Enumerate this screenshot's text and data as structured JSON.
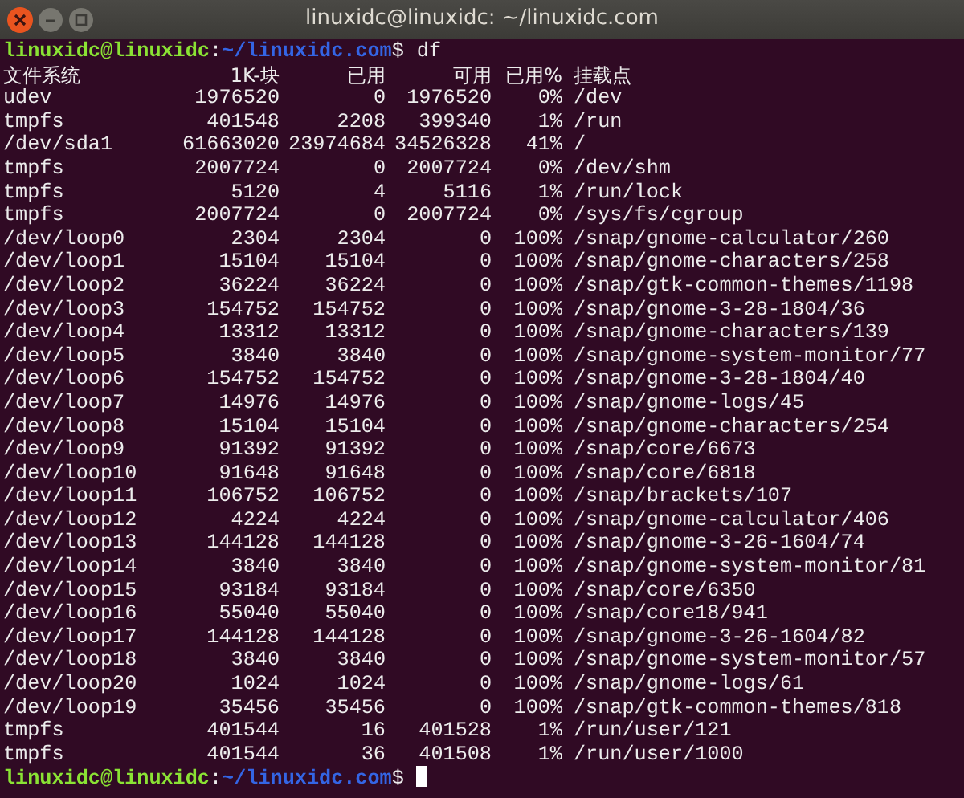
{
  "window": {
    "title": "linuxidc@linuxidc: ~/linuxidc.com"
  },
  "prompt": {
    "user_host": "linuxidc@linuxidc",
    "separator": ":",
    "path": "~/linuxidc.com",
    "symbol": "$",
    "command": "df"
  },
  "table": {
    "columns": [
      "文件系统",
      "1K-块",
      "已用",
      "可用",
      "已用%",
      "挂载点"
    ],
    "rows": [
      [
        "udev",
        "1976520",
        "0",
        "1976520",
        "0%",
        "/dev"
      ],
      [
        "tmpfs",
        "401548",
        "2208",
        "399340",
        "1%",
        "/run"
      ],
      [
        "/dev/sda1",
        "61663020",
        "23974684",
        "34526328",
        "41%",
        "/"
      ],
      [
        "tmpfs",
        "2007724",
        "0",
        "2007724",
        "0%",
        "/dev/shm"
      ],
      [
        "tmpfs",
        "5120",
        "4",
        "5116",
        "1%",
        "/run/lock"
      ],
      [
        "tmpfs",
        "2007724",
        "0",
        "2007724",
        "0%",
        "/sys/fs/cgroup"
      ],
      [
        "/dev/loop0",
        "2304",
        "2304",
        "0",
        "100%",
        "/snap/gnome-calculator/260"
      ],
      [
        "/dev/loop1",
        "15104",
        "15104",
        "0",
        "100%",
        "/snap/gnome-characters/258"
      ],
      [
        "/dev/loop2",
        "36224",
        "36224",
        "0",
        "100%",
        "/snap/gtk-common-themes/1198"
      ],
      [
        "/dev/loop3",
        "154752",
        "154752",
        "0",
        "100%",
        "/snap/gnome-3-28-1804/36"
      ],
      [
        "/dev/loop4",
        "13312",
        "13312",
        "0",
        "100%",
        "/snap/gnome-characters/139"
      ],
      [
        "/dev/loop5",
        "3840",
        "3840",
        "0",
        "100%",
        "/snap/gnome-system-monitor/77"
      ],
      [
        "/dev/loop6",
        "154752",
        "154752",
        "0",
        "100%",
        "/snap/gnome-3-28-1804/40"
      ],
      [
        "/dev/loop7",
        "14976",
        "14976",
        "0",
        "100%",
        "/snap/gnome-logs/45"
      ],
      [
        "/dev/loop8",
        "15104",
        "15104",
        "0",
        "100%",
        "/snap/gnome-characters/254"
      ],
      [
        "/dev/loop9",
        "91392",
        "91392",
        "0",
        "100%",
        "/snap/core/6673"
      ],
      [
        "/dev/loop10",
        "91648",
        "91648",
        "0",
        "100%",
        "/snap/core/6818"
      ],
      [
        "/dev/loop11",
        "106752",
        "106752",
        "0",
        "100%",
        "/snap/brackets/107"
      ],
      [
        "/dev/loop12",
        "4224",
        "4224",
        "0",
        "100%",
        "/snap/gnome-calculator/406"
      ],
      [
        "/dev/loop13",
        "144128",
        "144128",
        "0",
        "100%",
        "/snap/gnome-3-26-1604/74"
      ],
      [
        "/dev/loop14",
        "3840",
        "3840",
        "0",
        "100%",
        "/snap/gnome-system-monitor/81"
      ],
      [
        "/dev/loop15",
        "93184",
        "93184",
        "0",
        "100%",
        "/snap/core/6350"
      ],
      [
        "/dev/loop16",
        "55040",
        "55040",
        "0",
        "100%",
        "/snap/core18/941"
      ],
      [
        "/dev/loop17",
        "144128",
        "144128",
        "0",
        "100%",
        "/snap/gnome-3-26-1604/82"
      ],
      [
        "/dev/loop18",
        "3840",
        "3840",
        "0",
        "100%",
        "/snap/gnome-system-monitor/57"
      ],
      [
        "/dev/loop20",
        "1024",
        "1024",
        "0",
        "100%",
        "/snap/gnome-logs/61"
      ],
      [
        "/dev/loop19",
        "35456",
        "35456",
        "0",
        "100%",
        "/snap/gtk-common-themes/818"
      ],
      [
        "tmpfs",
        "401544",
        "16",
        "401528",
        "1%",
        "/run/user/121"
      ],
      [
        "tmpfs",
        "401544",
        "36",
        "401508",
        "1%",
        "/run/user/1000"
      ]
    ]
  },
  "final_prompt": {
    "user_host": "linuxidc@linuxidc",
    "separator": ":",
    "path": "~/linuxidc.com",
    "symbol": "$"
  }
}
